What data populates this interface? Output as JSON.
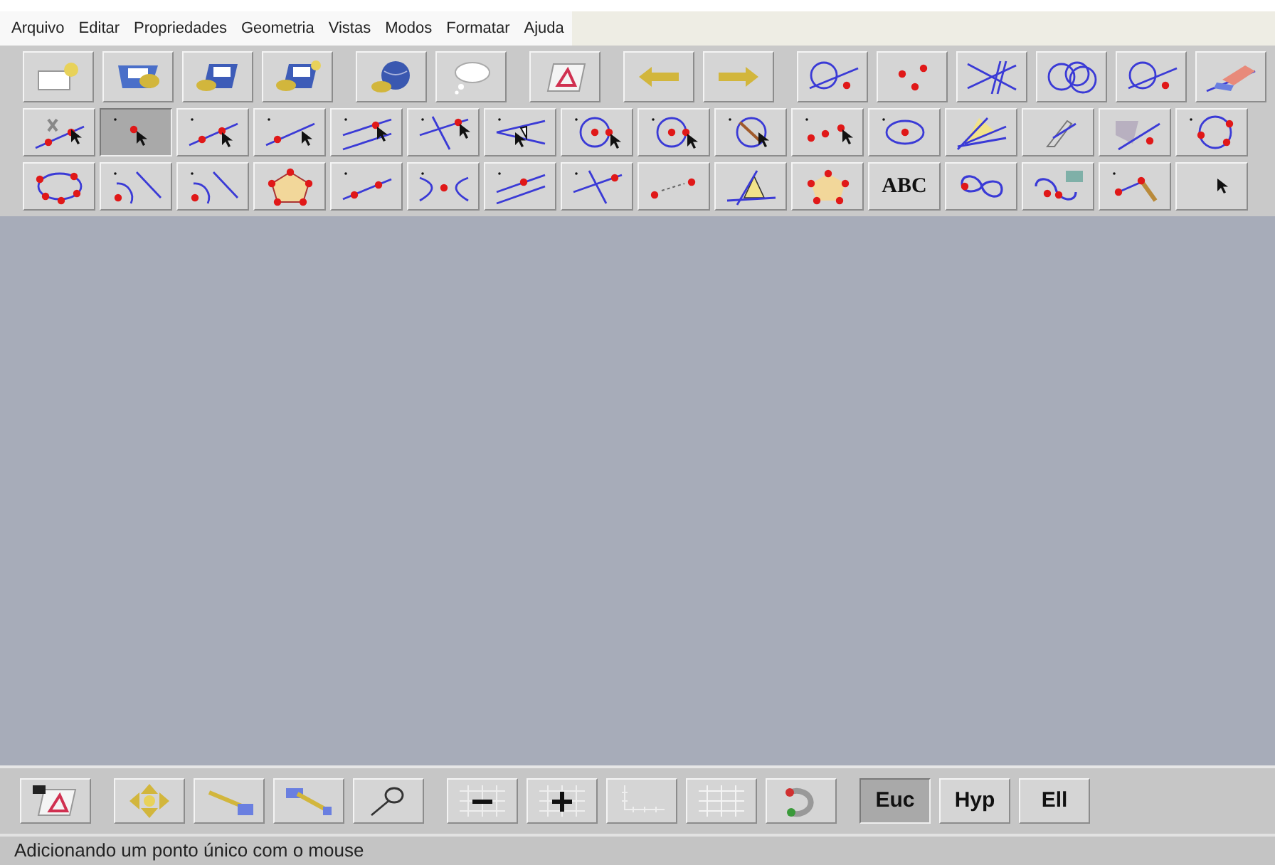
{
  "menu": [
    "Arquivo",
    "Editar",
    "Propriedades",
    "Geometria",
    "Vistas",
    "Modos",
    "Formatar",
    "Ajuda"
  ],
  "main_toolbar": [
    [
      {
        "kind": "new"
      },
      {
        "kind": "open"
      },
      {
        "kind": "save"
      },
      {
        "kind": "saveas"
      }
    ],
    [
      {
        "kind": "globe"
      },
      {
        "kind": "help"
      }
    ],
    [
      {
        "kind": "macro"
      }
    ],
    [
      {
        "kind": "back"
      },
      {
        "kind": "forward"
      }
    ],
    [
      {
        "kind": "circle-line-point"
      },
      {
        "kind": "three-points"
      },
      {
        "kind": "crossing-lines"
      },
      {
        "kind": "circles"
      },
      {
        "kind": "circle-line-point"
      },
      {
        "kind": "eraser"
      }
    ]
  ],
  "tool_rows": [
    [
      {
        "kind": "move",
        "selected": false
      },
      {
        "kind": "point",
        "selected": true
      },
      {
        "kind": "line-two-points",
        "selected": false
      },
      {
        "kind": "line-one-point",
        "selected": false
      },
      {
        "kind": "parallel",
        "selected": false
      },
      {
        "kind": "perpendicular",
        "selected": false
      },
      {
        "kind": "angle",
        "selected": false
      },
      {
        "kind": "circle-center",
        "selected": false
      },
      {
        "kind": "circle-center",
        "selected": false
      },
      {
        "kind": "circle-radius",
        "selected": false
      },
      {
        "kind": "midpoint",
        "selected": false
      },
      {
        "kind": "circle-dot",
        "selected": false
      },
      {
        "kind": "bisector",
        "selected": false
      },
      {
        "kind": "compass",
        "selected": false
      },
      {
        "kind": "reflection",
        "selected": false
      },
      {
        "kind": "circle-three-points",
        "selected": false
      }
    ],
    [
      {
        "kind": "conic",
        "selected": false
      },
      {
        "kind": "arc",
        "selected": false
      },
      {
        "kind": "arc",
        "selected": false
      },
      {
        "kind": "pentagon",
        "selected": false
      },
      {
        "kind": "segment",
        "selected": false
      },
      {
        "kind": "intersection",
        "selected": false
      },
      {
        "kind": "parallel-point",
        "selected": false
      },
      {
        "kind": "perpendicular-point",
        "selected": false
      },
      {
        "kind": "distance",
        "selected": false
      },
      {
        "kind": "angle-measure",
        "selected": false
      },
      {
        "kind": "area-measure",
        "selected": false
      },
      {
        "kind": "text",
        "label": "ABC",
        "selected": false
      },
      {
        "kind": "locus",
        "selected": false
      },
      {
        "kind": "locus-label",
        "selected": false
      },
      {
        "kind": "trace",
        "selected": false
      },
      {
        "kind": "cursor",
        "selected": false
      }
    ]
  ],
  "bottom_toolbar": [
    [
      {
        "kind": "export"
      }
    ],
    [
      {
        "kind": "pan"
      },
      {
        "kind": "shift-left"
      },
      {
        "kind": "shift-right"
      },
      {
        "kind": "lasso"
      }
    ],
    [
      {
        "kind": "grid-minus"
      },
      {
        "kind": "grid-plus"
      },
      {
        "kind": "axes"
      },
      {
        "kind": "grid"
      },
      {
        "kind": "rotate"
      }
    ]
  ],
  "geometries": [
    {
      "label": "Euc",
      "selected": true
    },
    {
      "label": "Hyp",
      "selected": false
    },
    {
      "label": "Ell",
      "selected": false
    }
  ],
  "status_bar": "Adicionando um ponto único com o mouse"
}
